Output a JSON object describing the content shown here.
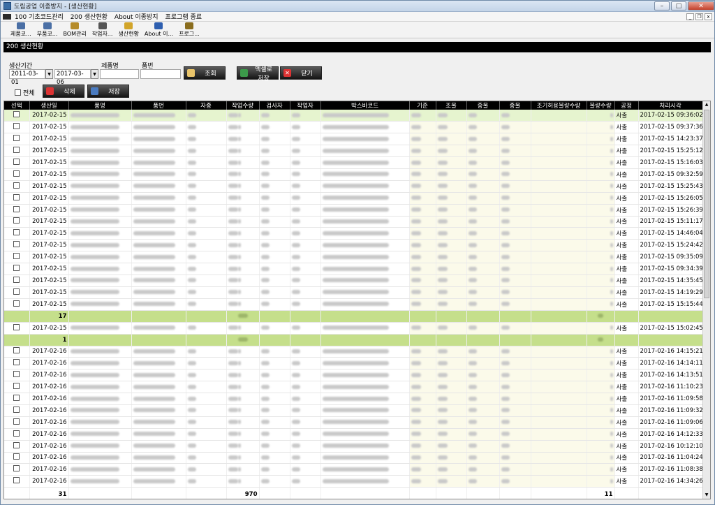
{
  "window": {
    "title": "도림공업 이종방지 - [생산현황]"
  },
  "menu": [
    "100 기초코드관리",
    "200 생산현황",
    "About 이종방지",
    "프로그램 종료"
  ],
  "toolbar": [
    {
      "label": "제품코...",
      "icon": "product-icon",
      "color": "#4a6fa5"
    },
    {
      "label": "부품코...",
      "icon": "part-icon",
      "color": "#4a6fa5"
    },
    {
      "label": "BOM관리",
      "icon": "bom-icon",
      "color": "#b58b2a"
    },
    {
      "label": "작업자...",
      "icon": "worker-icon",
      "color": "#555555"
    },
    {
      "label": "생산현황",
      "icon": "production-icon",
      "color": "#d2a52a"
    },
    {
      "label": "About 이...",
      "icon": "info-icon",
      "color": "#2e5fb0"
    },
    {
      "label": "프로그...",
      "icon": "exit-icon",
      "color": "#8a6d1e"
    }
  ],
  "section_title": "200 생산현황",
  "filters": {
    "period_label": "생산기간",
    "date_from": "2011-03-01",
    "date_to": "2017-03-06",
    "product_label": "제품명",
    "part_label": "품번",
    "product_value": "",
    "part_value": ""
  },
  "buttons": {
    "search": "조회",
    "excel": "엑셀로저장",
    "close": "닫기",
    "delete": "삭제",
    "save": "저장",
    "select_all": "전체"
  },
  "columns": [
    "선택",
    "생산일",
    "품명",
    "품번",
    "자종",
    "작업수량",
    "검사자",
    "작업자",
    "박스바코드",
    "기준",
    "조물",
    "중물",
    "종물",
    "조기허용불량수량",
    "불량수량",
    "공정",
    "처리시각"
  ],
  "group1": [
    {
      "date": "2017-02-15",
      "proc": "사출",
      "time": "2017-02-15 09:36:02"
    },
    {
      "date": "2017-02-15",
      "proc": "사출",
      "time": "2017-02-15 09:37:36"
    },
    {
      "date": "2017-02-15",
      "proc": "사출",
      "time": "2017-02-15 14:23:37"
    },
    {
      "date": "2017-02-15",
      "proc": "사출",
      "time": "2017-02-15 15:25:12"
    },
    {
      "date": "2017-02-15",
      "proc": "사출",
      "time": "2017-02-15 15:16:03"
    },
    {
      "date": "2017-02-15",
      "proc": "사출",
      "time": "2017-02-15 09:32:59"
    },
    {
      "date": "2017-02-15",
      "proc": "사출",
      "time": "2017-02-15 15:25:43"
    },
    {
      "date": "2017-02-15",
      "proc": "사출",
      "time": "2017-02-15 15:26:05"
    },
    {
      "date": "2017-02-15",
      "proc": "사출",
      "time": "2017-02-15 15:26:39"
    },
    {
      "date": "2017-02-15",
      "proc": "사출",
      "time": "2017-02-15 15:11:17"
    },
    {
      "date": "2017-02-15",
      "proc": "사출",
      "time": "2017-02-15 14:46:04"
    },
    {
      "date": "2017-02-15",
      "proc": "사출",
      "time": "2017-02-15 15:24:42"
    },
    {
      "date": "2017-02-15",
      "proc": "사출",
      "time": "2017-02-15 09:35:09"
    },
    {
      "date": "2017-02-15",
      "proc": "사출",
      "time": "2017-02-15 09:34:39"
    },
    {
      "date": "2017-02-15",
      "proc": "사출",
      "time": "2017-02-15 14:35:45"
    },
    {
      "date": "2017-02-15",
      "proc": "사출",
      "time": "2017-02-15 14:19:29"
    },
    {
      "date": "2017-02-15",
      "proc": "사출",
      "time": "2017-02-15 15:15:44"
    }
  ],
  "subtotal1": {
    "count": "17"
  },
  "group2": [
    {
      "date": "2017-02-15",
      "proc": "사출",
      "time": "2017-02-15 15:02:45"
    }
  ],
  "subtotal2": {
    "count": "1"
  },
  "group3": [
    {
      "date": "2017-02-16",
      "proc": "사출",
      "time": "2017-02-16 14:15:21"
    },
    {
      "date": "2017-02-16",
      "proc": "사출",
      "time": "2017-02-16 14:14:11"
    },
    {
      "date": "2017-02-16",
      "proc": "사출",
      "time": "2017-02-16 14:13:51"
    },
    {
      "date": "2017-02-16",
      "proc": "사출",
      "time": "2017-02-16 11:10:23"
    },
    {
      "date": "2017-02-16",
      "proc": "사출",
      "time": "2017-02-16 11:09:58"
    },
    {
      "date": "2017-02-16",
      "proc": "사출",
      "time": "2017-02-16 11:09:32"
    },
    {
      "date": "2017-02-16",
      "proc": "사출",
      "time": "2017-02-16 11:09:06"
    },
    {
      "date": "2017-02-16",
      "proc": "사출",
      "time": "2017-02-16 14:12:33"
    },
    {
      "date": "2017-02-16",
      "proc": "사출",
      "time": "2017-02-16 10:12:10"
    },
    {
      "date": "2017-02-16",
      "proc": "사출",
      "time": "2017-02-16 11:04:24"
    },
    {
      "date": "2017-02-16",
      "proc": "사출",
      "time": "2017-02-16 11:08:38"
    },
    {
      "date": "2017-02-16",
      "proc": "사출",
      "time": "2017-02-16 14:34:26"
    }
  ],
  "footer": {
    "count": "31",
    "quantity": "970",
    "defects": "11"
  }
}
